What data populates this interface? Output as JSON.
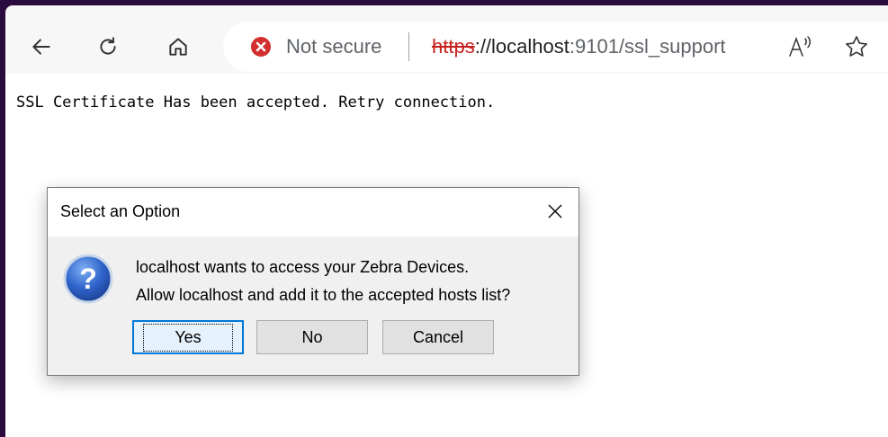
{
  "browser": {
    "address": {
      "security_label": "Not secure",
      "url_scheme": "https",
      "url_host": "://localhost",
      "url_rest": ":9101/ssl_support"
    },
    "icons": [
      "back-icon",
      "refresh-icon",
      "home-icon",
      "not-secure-icon",
      "read-aloud-icon",
      "favorite-star-icon"
    ],
    "colors": {
      "insecure": "#d32f2f",
      "chrome": "#f7f7f7",
      "frame": "#2b0a3d"
    }
  },
  "page": {
    "message": "SSL Certificate Has been accepted. Retry connection."
  },
  "dialog": {
    "title": "Select an Option",
    "line1": "localhost wants to access your Zebra Devices.",
    "line2": "Allow localhost and add it to the accepted hosts list?",
    "buttons": {
      "yes": "Yes",
      "no": "No",
      "cancel": "Cancel"
    },
    "icon": "question-icon"
  }
}
